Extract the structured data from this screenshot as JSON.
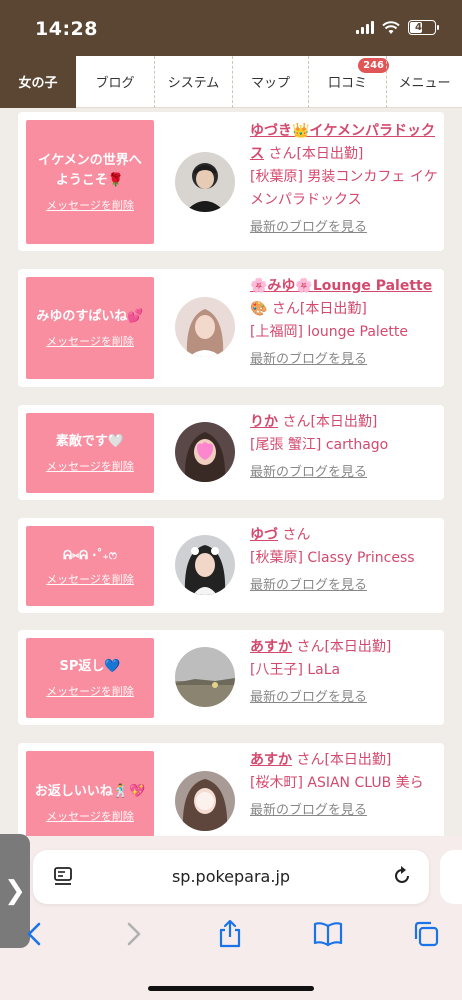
{
  "status": {
    "time": "14:28",
    "battery": "45"
  },
  "nav": {
    "items": [
      {
        "label": "女の子"
      },
      {
        "label": "ブログ"
      },
      {
        "label": "システム"
      },
      {
        "label": "マップ"
      },
      {
        "label": "口コミ",
        "badge": "246"
      },
      {
        "label": "メニュー"
      }
    ]
  },
  "cards": [
    {
      "message": "イケメンの世界へようこそ🌹",
      "delete": "メッセージを削除",
      "name": "ゆづき👑イケメンパラドックス",
      "san": "さん",
      "status": "[本日出勤]",
      "shop": "[秋葉原] 男装コンカフェ イケメンパラドックス",
      "blog": "最新のブログを見る"
    },
    {
      "message": "みゆのすぱいね💕",
      "delete": "メッセージを削除",
      "name": "🌸みゆ🌸Lounge Palette",
      "san": "🎨 さん",
      "status": "[本日出勤]",
      "shop": "[上福岡] lounge Palette",
      "blog": "最新のブログを見る"
    },
    {
      "message": "素敵です🤍",
      "delete": "メッセージを削除",
      "name": "りか",
      "san": "さん",
      "status": "[本日出勤]",
      "shop": "[尾張 蟹江] carthago",
      "blog": "最新のブログを見る"
    },
    {
      "message": "ᕱ⑅ᕱ ‧˚₊ෆ",
      "delete": "メッセージを削除",
      "name": "ゆづ",
      "san": "さん",
      "status": "",
      "shop": "[秋葉原] Classy Princess",
      "blog": "最新のブログを見る"
    },
    {
      "message": "SP返し💙",
      "delete": "メッセージを削除",
      "name": "あすか",
      "san": "さん",
      "status": "[本日出勤]",
      "shop": "[八王子] LaLa",
      "blog": "最新のブログを見る"
    },
    {
      "message": "お返しいいね🕺💖",
      "delete": "メッセージを削除",
      "name": "あすか",
      "san": "さん",
      "status": "[本日出勤]",
      "shop": "[桜木町] ASIAN CLUB 美ら",
      "blog": "最新のブログを見る"
    }
  ],
  "browser": {
    "url": "sp.pokepara.jp"
  },
  "colors": {
    "accent": "#d44a6e",
    "message_bg": "#f98ea1",
    "header_bg": "#5a4632"
  }
}
